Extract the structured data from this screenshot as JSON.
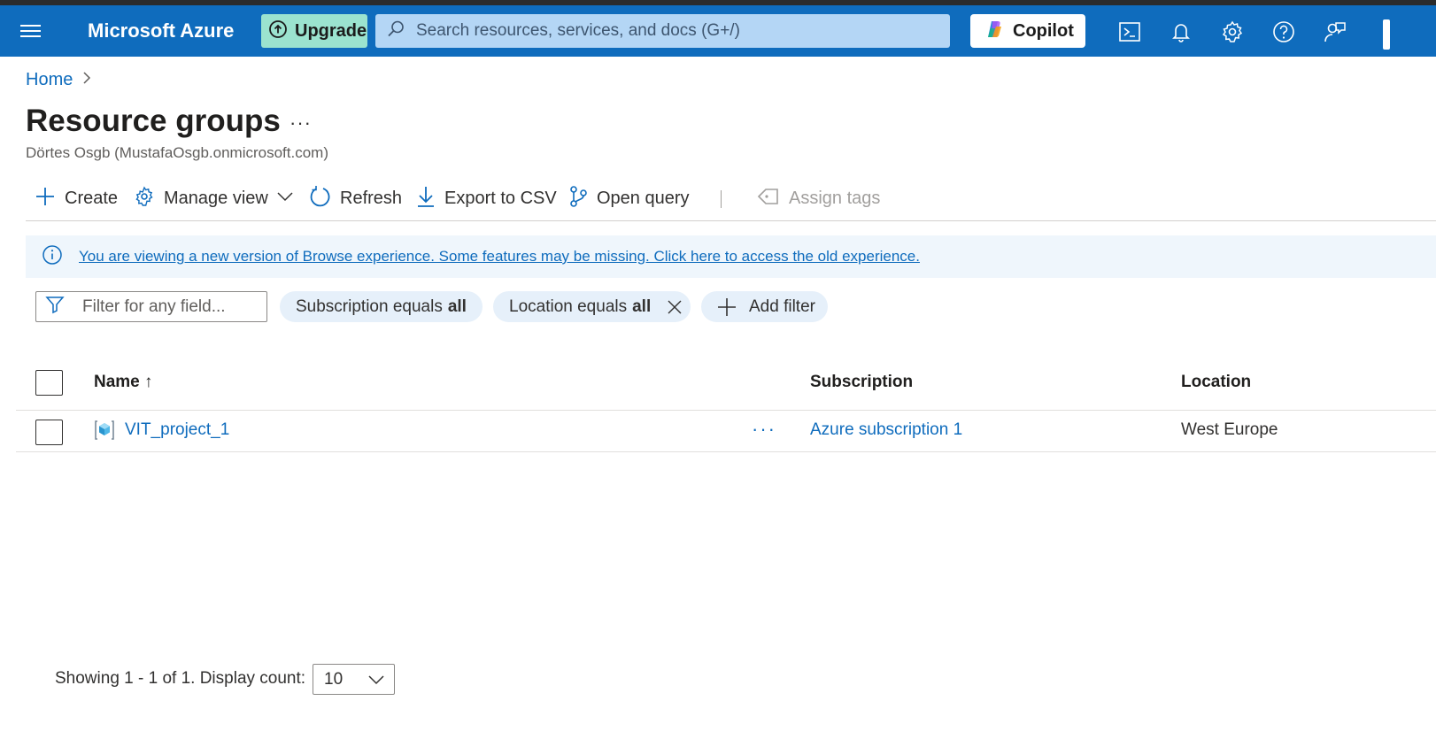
{
  "header": {
    "brand": "Microsoft Azure",
    "upgrade_label": "Upgrade",
    "search_placeholder": "Search resources, services, and docs (G+/)",
    "copilot_label": "Copilot",
    "icons": [
      "menu-icon",
      "upgrade-icon",
      "search-icon",
      "copilot-icon",
      "cloud-shell-icon",
      "notifications-icon",
      "settings-icon",
      "help-icon",
      "feedback-icon"
    ],
    "accent_color": "#0f6cbd"
  },
  "breadcrumb": {
    "home": "Home"
  },
  "page": {
    "title": "Resource groups",
    "more": "···",
    "subtitle": "Dörtes Osgb (MustafaOsgb.onmicrosoft.com)"
  },
  "toolbar": {
    "create": "Create",
    "manage_view": "Manage view",
    "refresh": "Refresh",
    "export_csv": "Export to CSV",
    "open_query": "Open query",
    "assign_tags": "Assign tags"
  },
  "banner": {
    "text": "You are viewing a new version of Browse experience. Some features may be missing. Click here to access the old experience."
  },
  "filters": {
    "placeholder": "Filter for any field...",
    "subscription_prefix": "Subscription equals",
    "subscription_value": "all",
    "location_prefix": "Location equals",
    "location_value": "all",
    "add_filter": "Add filter"
  },
  "table": {
    "columns": {
      "name": "Name ↑",
      "subscription": "Subscription",
      "location": "Location"
    },
    "rows": [
      {
        "name": "VIT_project_1",
        "more": "···",
        "subscription": "Azure subscription 1",
        "location": "West Europe"
      }
    ]
  },
  "footer": {
    "showing": "Showing 1 - 1 of 1. Display count:",
    "display_count": "10"
  }
}
